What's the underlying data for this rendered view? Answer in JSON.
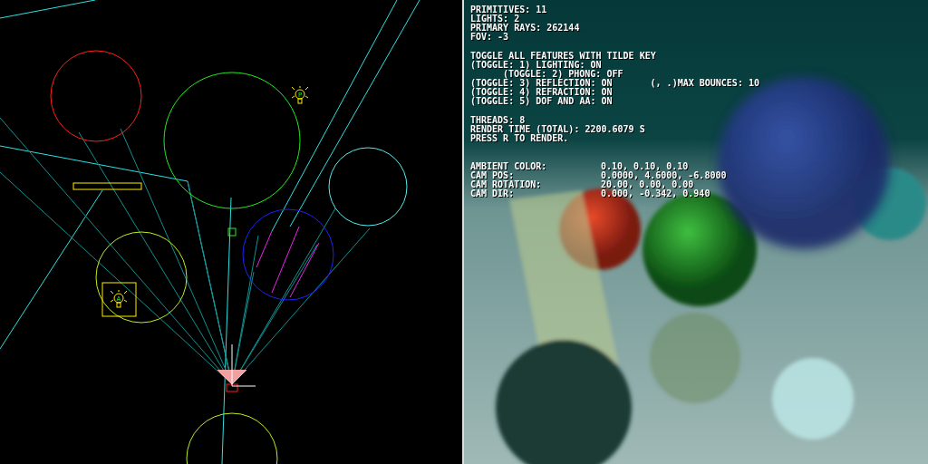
{
  "scene_view": {
    "lights": [
      {
        "label": "P",
        "selected": false
      },
      {
        "label": "A",
        "selected": true
      }
    ]
  },
  "render_view": {
    "stats": [
      "PRIMITIVES: 11",
      "LIGHTS: 2",
      "PRIMARY RAYS: 262144",
      "FOV: -3"
    ],
    "toggle_header": "TOGGLE ALL FEATURES WITH TILDE KEY",
    "toggles": [
      {
        "text": "(TOGGLE: 1) LIGHTING: ON",
        "children": [
          {
            "text": "(TOGGLE: 2) PHONG: OFF"
          }
        ]
      },
      {
        "text": "(TOGGLE: 3) REFLECTION: ON",
        "extra": "(, .)MAX BOUNCES: 10"
      },
      {
        "text": "(TOGGLE: 4) REFRACTION: ON"
      },
      {
        "text": "(TOGGLE: 5) DOF AND AA: ON"
      }
    ],
    "render_info": [
      "THREADS: 8",
      "RENDER TIME (TOTAL): 2200.6079 S",
      "PRESS R TO RENDER."
    ],
    "camera": [
      {
        "label": "AMBIENT COLOR:",
        "value": "0.10, 0.10, 0.10"
      },
      {
        "label": "CAM POS:",
        "value": "0.0000, 4.6000, -6.8000"
      },
      {
        "label": "CAM ROTATION:",
        "value": "20.00, 0.00, 0.00"
      },
      {
        "label": "CAM DIR:",
        "value": "0.000, -0.342, 0.940"
      }
    ]
  }
}
